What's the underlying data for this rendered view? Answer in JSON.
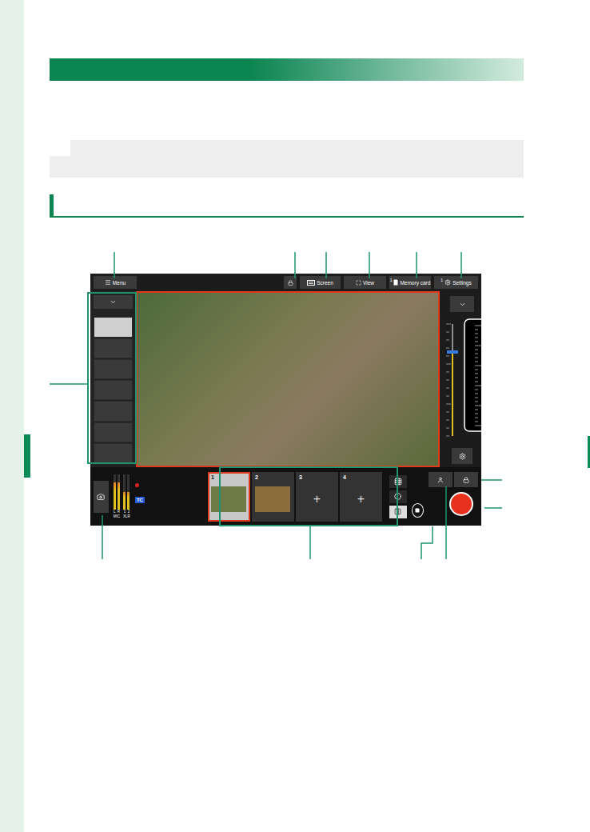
{
  "toolbar": {
    "menu": "Menu",
    "screen": "Screen",
    "view": "View",
    "memory_card": {
      "slot": "1",
      "label": "Memory card"
    },
    "settings": {
      "slot": "1",
      "label": "Settings"
    }
  },
  "side_list": [
    {
      "selected": true
    },
    {
      "selected": false
    },
    {
      "selected": false
    },
    {
      "selected": false
    },
    {
      "selected": false
    },
    {
      "selected": false
    },
    {
      "selected": false
    }
  ],
  "exposure_scale": {
    "level": 0.75
  },
  "meters": [
    {
      "label": "L",
      "level": 0.78
    },
    {
      "label": "R",
      "level": 0.78
    },
    {
      "label": "1",
      "level": 0.5
    },
    {
      "label": "2",
      "level": 0.5
    }
  ],
  "meter_groups": [
    "MIC",
    "XLR"
  ],
  "status": {
    "recording_dot": true,
    "badge": "TC"
  },
  "tiles": [
    {
      "number": "1",
      "kind": "photo",
      "selected": true,
      "color": "#6f7a45",
      "add": ""
    },
    {
      "number": "2",
      "kind": "photo",
      "selected": false,
      "color": "#8a6d3a",
      "add": ""
    },
    {
      "number": "3",
      "kind": "empty",
      "selected": false,
      "color": "#3a3a3a",
      "add": "+"
    },
    {
      "number": "4",
      "kind": "empty",
      "selected": false,
      "color": "#3a3a3a",
      "add": "+"
    }
  ]
}
